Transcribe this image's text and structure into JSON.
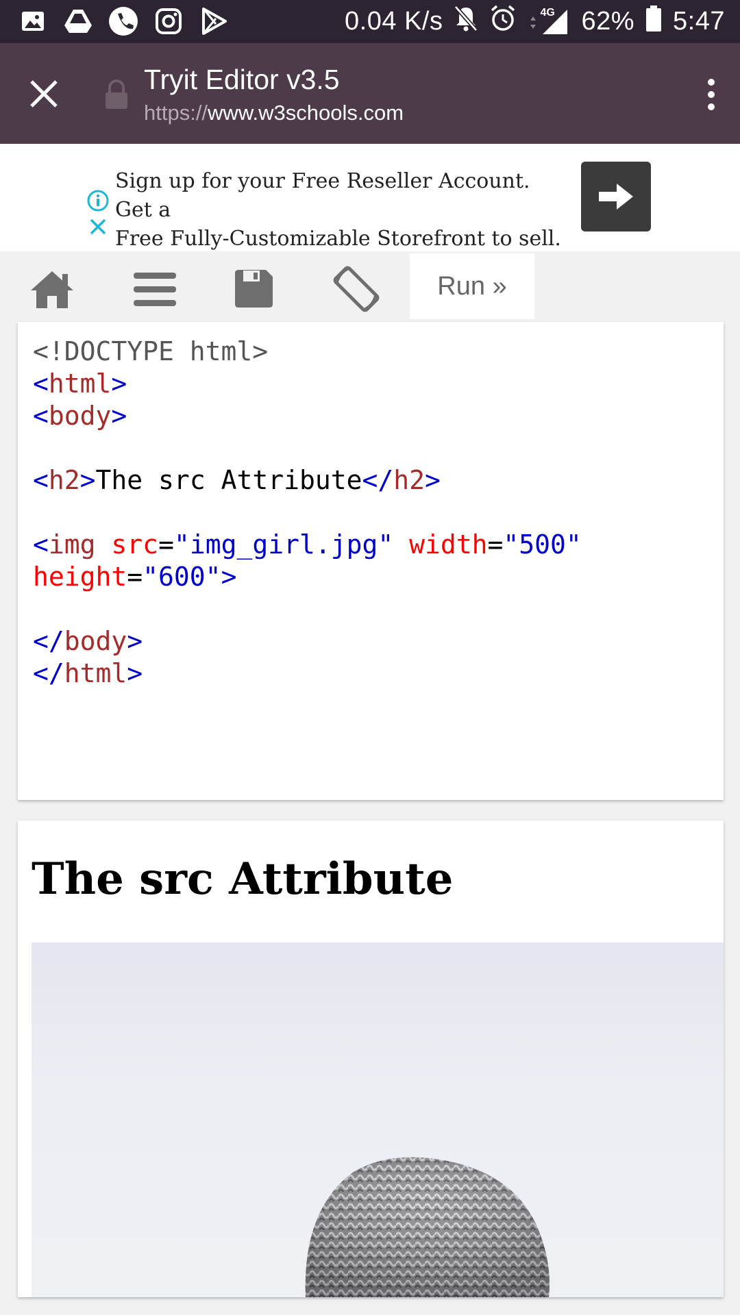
{
  "status_bar": {
    "network_speed": "0.04 K/s",
    "network_type": "4G",
    "battery": "62%",
    "time": "5:47",
    "left_icons": [
      "gallery-icon",
      "drive-icon",
      "phone-icon",
      "instagram-icon",
      "play-store-icon"
    ],
    "right_icons": [
      "mute-bell-icon",
      "alarm-icon",
      "signal-icon",
      "battery-icon"
    ]
  },
  "toolbar": {
    "title": "Tryit Editor v3.5",
    "url_scheme": "https://",
    "url_host": "www.w3schools.com",
    "background": "#4d3b4a"
  },
  "ad": {
    "line1": "Sign up for your Free Reseller Account. Get a",
    "line2": "Free Fully-Customizable Storefront to sell.",
    "accent": "#1fb5d4"
  },
  "editor_toolbar": {
    "buttons": [
      "home-icon",
      "menu-icon",
      "save-icon",
      "rotate-icon"
    ],
    "run_label": "Run »"
  },
  "code": {
    "doctype": "<!DOCTYPE html>",
    "html_tag": "html",
    "body_tag": "body",
    "h2_tag": "h2",
    "h2_text": "The src Attribute",
    "img_tag": "img",
    "src_attr": "src",
    "src_val": "\"img_girl.jpg\"",
    "width_attr": "width",
    "width_val": "\"500\"",
    "height_attr": "height",
    "height_val": "\"600\""
  },
  "result": {
    "heading": "The src Attribute"
  }
}
